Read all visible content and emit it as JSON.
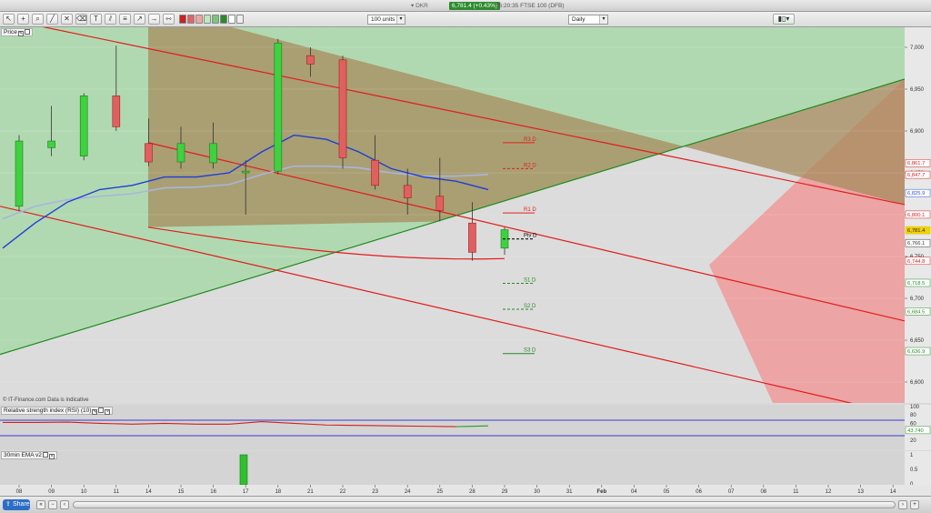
{
  "window": {
    "instrument_label": "▾ DKR",
    "price_badge": "6,781.4 (+0.43%)",
    "price_suffix": "06:20:35 FTSE 100 (DFB)"
  },
  "toolbar": {
    "units_value": "100 units",
    "timeframe_value": "Daily",
    "chart_style_icon": "candlestick-icon",
    "swatch_colors": [
      "#c22",
      "#d66",
      "#f1a4a4",
      "#c1e7c1",
      "#7dc37d",
      "#2a8a2a",
      "#fff",
      "#eee"
    ]
  },
  "price_panel": {
    "title": "Price",
    "footnote": "© IT-Finance.com  Data is indicative",
    "y_ticks": [
      "7,000",
      "6,950",
      "6,900",
      "6,850",
      "6,800",
      "6,750",
      "6,700",
      "6,650",
      "6,600"
    ],
    "pivot_labels": [
      "R3 D",
      "R2 D",
      "R1 D",
      "Piv D",
      "S1 D",
      "S2 D",
      "S3 D"
    ],
    "price_tags": [
      {
        "text": "6,861.7",
        "color": "#d02020"
      },
      {
        "text": "6,847.7",
        "color": "#d02020"
      },
      {
        "text": "6,825.9",
        "color": "#2a4fd0"
      },
      {
        "text": "6,800.1",
        "color": "#d02020"
      },
      {
        "text": "6,781.4",
        "color": "#e8c000"
      },
      {
        "text": "6,766.1",
        "color": "#333"
      },
      {
        "text": "6,744.8",
        "color": "#d02020"
      },
      {
        "text": "6,718.5",
        "color": "#2a8a2a"
      },
      {
        "text": "6,684.5",
        "color": "#2a8a2a"
      },
      {
        "text": "6,636.9",
        "color": "#2a8a2a"
      }
    ]
  },
  "rsi_panel": {
    "title": "Relative strength index (RSI) (10)",
    "y_ticks": [
      "100",
      "80",
      "60",
      "20"
    ],
    "value_tag": "43.740"
  },
  "ema_panel": {
    "title": "30min EMA v2",
    "y_ticks": [
      "1",
      "0.5",
      "0"
    ]
  },
  "x_axis": {
    "labels": [
      "08",
      "09",
      "10",
      "11",
      "14",
      "15",
      "16",
      "17",
      "18",
      "21",
      "22",
      "23",
      "24",
      "25",
      "28",
      "29",
      "30",
      "31",
      "Feb",
      "04",
      "05",
      "06",
      "07",
      "08",
      "11",
      "12",
      "13",
      "14"
    ]
  },
  "bottombar": {
    "share_label": "Share"
  },
  "chart_data": {
    "type": "candlestick",
    "categories": [
      "08",
      "09",
      "10",
      "11",
      "14",
      "15",
      "16",
      "17",
      "18",
      "21",
      "22",
      "23",
      "24",
      "25",
      "28",
      "29"
    ],
    "ohlc": [
      [
        6810,
        6895,
        6805,
        6888
      ],
      [
        6880,
        6930,
        6870,
        6888
      ],
      [
        6870,
        6945,
        6865,
        6942
      ],
      [
        6942,
        7002,
        6900,
        6905
      ],
      [
        6885,
        6915,
        6858,
        6863
      ],
      [
        6863,
        6905,
        6855,
        6885
      ],
      [
        6862,
        6910,
        6855,
        6885
      ],
      [
        6850,
        6865,
        6800,
        6852
      ],
      [
        6852,
        7010,
        6848,
        7005
      ],
      [
        6990,
        7000,
        6965,
        6980
      ],
      [
        6985,
        6990,
        6855,
        6868
      ],
      [
        6865,
        6895,
        6830,
        6835
      ],
      [
        6835,
        6855,
        6800,
        6820
      ],
      [
        6822,
        6868,
        6792,
        6805
      ],
      [
        6790,
        6815,
        6745,
        6755
      ],
      [
        6760,
        6785,
        6752,
        6782
      ]
    ],
    "ema_blue": [
      6760,
      6790,
      6815,
      6830,
      6835,
      6845,
      6845,
      6850,
      6875,
      6895,
      6890,
      6875,
      6855,
      6845,
      6840,
      6830
    ],
    "ema_grey": [
      6795,
      6810,
      6818,
      6822,
      6825,
      6832,
      6833,
      6836,
      6848,
      6858,
      6858,
      6856,
      6850,
      6846,
      6846,
      6848
    ],
    "pivots": {
      "R3": 6886,
      "R2": 6855,
      "R1": 6802,
      "P": 6771,
      "S1": 6718,
      "S2": 6687,
      "S3": 6634
    },
    "rsi": [
      62,
      62,
      63,
      60,
      58,
      60,
      58,
      58,
      64,
      60,
      56,
      55,
      54,
      53,
      52,
      54
    ],
    "ylim": [
      6585,
      7020
    ]
  }
}
